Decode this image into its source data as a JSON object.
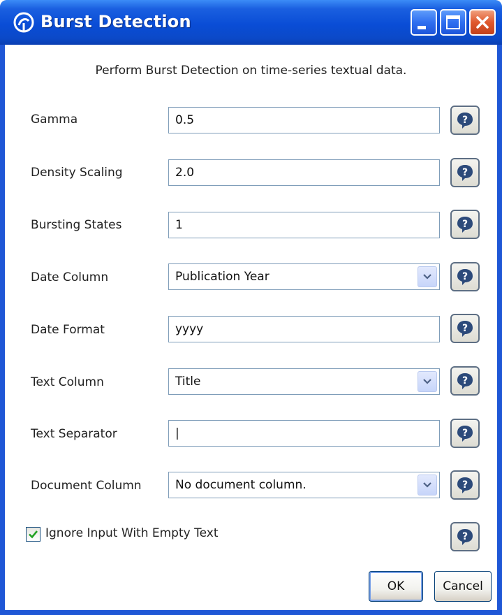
{
  "window": {
    "title": "Burst Detection",
    "title_bar_color": "#0a4dd6"
  },
  "description": "Perform Burst Detection on time-series textual data.",
  "fields": {
    "gamma": {
      "label": "Gamma",
      "value": "0.5"
    },
    "density_scaling": {
      "label": "Density Scaling",
      "value": "2.0"
    },
    "bursting_states": {
      "label": "Bursting States",
      "value": "1"
    },
    "date_column": {
      "label": "Date Column",
      "value": "Publication Year"
    },
    "date_format": {
      "label": "Date Format",
      "value": "yyyy"
    },
    "text_column": {
      "label": "Text Column",
      "value": "Title"
    },
    "text_separator": {
      "label": "Text Separator",
      "value": "|"
    },
    "document_column": {
      "label": "Document Column",
      "value": "No document column."
    }
  },
  "ignore_empty": {
    "label": "Ignore Input With Empty Text",
    "checked": true
  },
  "buttons": {
    "ok": "OK",
    "cancel": "Cancel"
  },
  "icons": {
    "app": "app-logo-icon",
    "minimize": "minimize-icon",
    "maximize": "maximize-icon",
    "close": "close-icon",
    "help": "help-icon",
    "dropdown": "chevron-down-icon",
    "check": "checkmark-icon"
  }
}
